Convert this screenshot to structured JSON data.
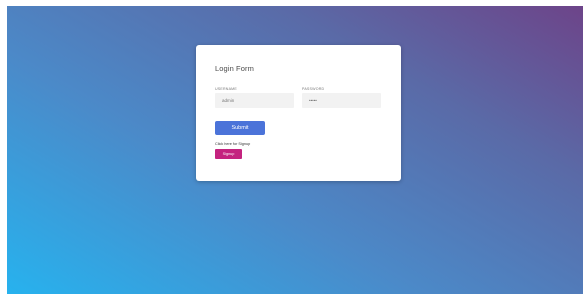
{
  "colors": {
    "gradient_top_right": "#6d4489",
    "gradient_bottom_left": "#27b2ee",
    "card": "#ffffff",
    "submit_button": "#4b73d9",
    "signup_button": "#c4237f"
  },
  "login": {
    "title": "Login Form",
    "username_label": "USERNAME",
    "username_value": "admin",
    "password_label": "PASSWORD",
    "password_value": "•••••",
    "submit_label": "Submit",
    "signup_hint": "Click here for Signup",
    "signup_label": "Signup"
  }
}
